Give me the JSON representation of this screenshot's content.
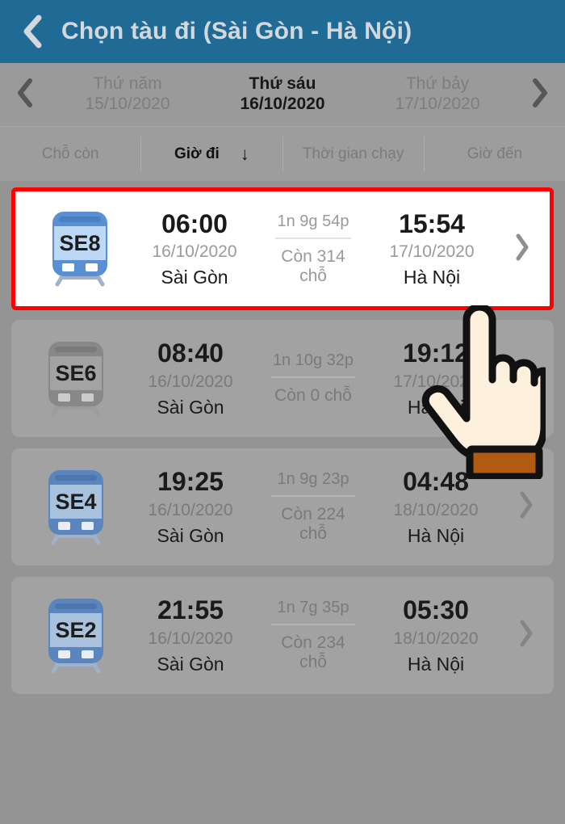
{
  "header": {
    "back_icon": "chevron-left-icon",
    "title": "Chọn tàu đi (Sài Gòn - Hà Nội)",
    "background": "#1f6b96"
  },
  "date_nav": {
    "prev_icon": "chevron-left-icon",
    "next_icon": "chevron-right-icon",
    "days": [
      {
        "dow": "Thứ năm",
        "date": "15/10/2020",
        "active": false
      },
      {
        "dow": "Thứ sáu",
        "date": "16/10/2020",
        "active": true
      },
      {
        "dow": "Thứ bảy",
        "date": "17/10/2020",
        "active": false
      }
    ]
  },
  "sort_bar": {
    "items": [
      {
        "label": "Chỗ còn",
        "active": false,
        "arrow": ""
      },
      {
        "label": "Giờ đi",
        "active": true,
        "arrow": "↓"
      },
      {
        "label": "Thời gian chạy",
        "active": false,
        "arrow": ""
      },
      {
        "label": "Giờ đến",
        "active": false,
        "arrow": ""
      }
    ]
  },
  "trains": [
    {
      "code": "SE8",
      "depart_time": "06:00",
      "depart_date": "16/10/2020",
      "depart_station": "Sài Gòn",
      "duration": "1n 9g 54p",
      "seats": "Còn 314 chỗ",
      "arrive_time": "15:54",
      "arrive_date": "17/10/2020",
      "arrive_station": "Hà Nội",
      "highlighted": true,
      "available": true,
      "chevron_icon": "chevron-right-icon"
    },
    {
      "code": "SE6",
      "depart_time": "08:40",
      "depart_date": "16/10/2020",
      "depart_station": "Sài Gòn",
      "duration": "1n 10g 32p",
      "seats": "Còn 0 chỗ",
      "arrive_time": "19:12",
      "arrive_date": "17/10/2020",
      "arrive_station": "Hà Nội",
      "highlighted": false,
      "available": false,
      "chevron_icon": "chevron-right-icon"
    },
    {
      "code": "SE4",
      "depart_time": "19:25",
      "depart_date": "16/10/2020",
      "depart_station": "Sài Gòn",
      "duration": "1n 9g 23p",
      "seats": "Còn 224 chỗ",
      "arrive_time": "04:48",
      "arrive_date": "18/10/2020",
      "arrive_station": "Hà Nội",
      "highlighted": false,
      "available": true,
      "chevron_icon": "chevron-right-icon"
    },
    {
      "code": "SE2",
      "depart_time": "21:55",
      "depart_date": "16/10/2020",
      "depart_station": "Sài Gòn",
      "duration": "1n 7g 35p",
      "seats": "Còn 234 chỗ",
      "arrive_time": "05:30",
      "arrive_date": "18/10/2020",
      "arrive_station": "Hà Nội",
      "highlighted": false,
      "available": true,
      "chevron_icon": "chevron-right-icon"
    }
  ],
  "cursor": {
    "icon": "pointing-hand-cursor"
  },
  "colors": {
    "header_blue": "#1f6b96",
    "page_gray": "#949494",
    "card_gray": "#a2a2a2",
    "highlight_red": "#fe0000",
    "train_blue": "#5b8fd4",
    "train_blue_light": "#b4d2f2",
    "train_gray": "#8a8a8a",
    "train_gray_light": "#a0a0a0"
  }
}
